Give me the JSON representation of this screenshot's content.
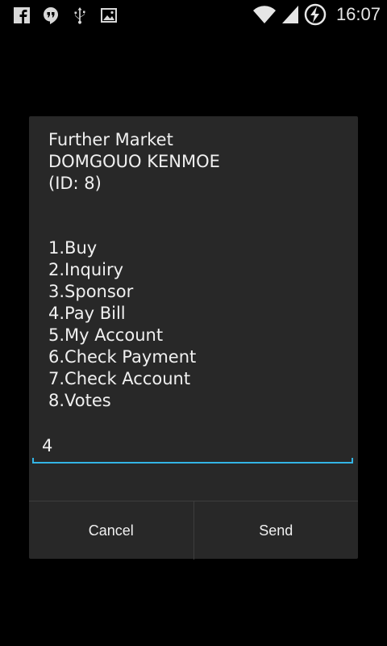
{
  "status_bar": {
    "time": "16:07",
    "icons_left": [
      "facebook-icon",
      "hangouts-icon",
      "usb-icon",
      "image-icon"
    ],
    "icons_right": [
      "wifi-icon",
      "signal-icon",
      "battery-charging-icon"
    ]
  },
  "dialog": {
    "message_lines": "Further Market\nDOMGOUO KENMOE\n(ID: 8)",
    "menu": [
      "1.Buy",
      "2.Inquiry",
      "3.Sponsor",
      "4.Pay Bill",
      "5.My Account",
      "6.Check Payment",
      "7.Check Account",
      "8.Votes"
    ],
    "input_value": "4",
    "cancel_label": "Cancel",
    "send_label": "Send"
  },
  "colors": {
    "accent": "#33b5e5",
    "dialog_bg": "#282828"
  }
}
